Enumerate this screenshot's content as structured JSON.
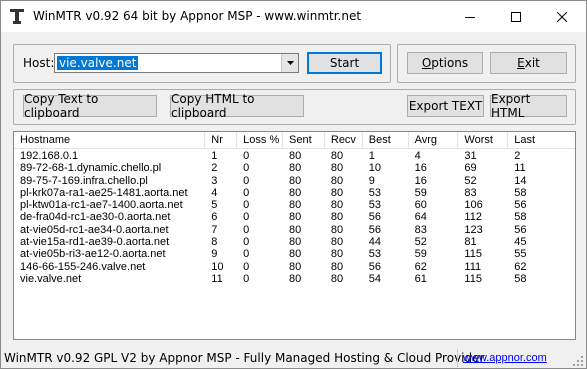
{
  "window": {
    "title": "WinMTR v0.92 64 bit by Appnor MSP - www.winmtr.net"
  },
  "host": {
    "label": "Host:",
    "value": "vie.valve.net"
  },
  "buttons": {
    "start": "Start",
    "options": "Options",
    "exit": "Exit",
    "copy_text": "Copy Text to clipboard",
    "copy_html": "Copy HTML to clipboard",
    "export_text": "Export TEXT",
    "export_html": "Export HTML"
  },
  "table": {
    "columns": [
      "Hostname",
      "Nr",
      "Loss %",
      "Sent",
      "Recv",
      "Best",
      "Avrg",
      "Worst",
      "Last"
    ],
    "rows": [
      [
        "192.168.0.1",
        "1",
        "0",
        "80",
        "80",
        "1",
        "4",
        "31",
        "2"
      ],
      [
        "89-72-68-1.dynamic.chello.pl",
        "2",
        "0",
        "80",
        "80",
        "10",
        "16",
        "69",
        "11"
      ],
      [
        "89-75-7-169.infra.chello.pl",
        "3",
        "0",
        "80",
        "80",
        "9",
        "16",
        "52",
        "14"
      ],
      [
        "pl-krk07a-ra1-ae25-1481.aorta.net",
        "4",
        "0",
        "80",
        "80",
        "53",
        "59",
        "83",
        "58"
      ],
      [
        "pl-ktw01a-rc1-ae7-1400.aorta.net",
        "5",
        "0",
        "80",
        "80",
        "53",
        "60",
        "106",
        "56"
      ],
      [
        "de-fra04d-rc1-ae30-0.aorta.net",
        "6",
        "0",
        "80",
        "80",
        "56",
        "64",
        "112",
        "58"
      ],
      [
        "at-vie05d-rc1-ae34-0.aorta.net",
        "7",
        "0",
        "80",
        "80",
        "56",
        "83",
        "123",
        "56"
      ],
      [
        "at-vie15a-rd1-ae39-0.aorta.net",
        "8",
        "0",
        "80",
        "80",
        "44",
        "52",
        "81",
        "45"
      ],
      [
        "at-vie05b-ri3-ae12-0.aorta.net",
        "9",
        "0",
        "80",
        "80",
        "53",
        "59",
        "115",
        "55"
      ],
      [
        "146-66-155-246.valve.net",
        "10",
        "0",
        "80",
        "80",
        "56",
        "62",
        "111",
        "62"
      ],
      [
        "vie.valve.net",
        "11",
        "0",
        "80",
        "80",
        "54",
        "61",
        "115",
        "58"
      ]
    ]
  },
  "status": {
    "text": "WinMTR v0.92 GPL V2 by Appnor MSP - Fully Managed Hosting & Cloud Provider",
    "link": "www.appnor.com"
  }
}
